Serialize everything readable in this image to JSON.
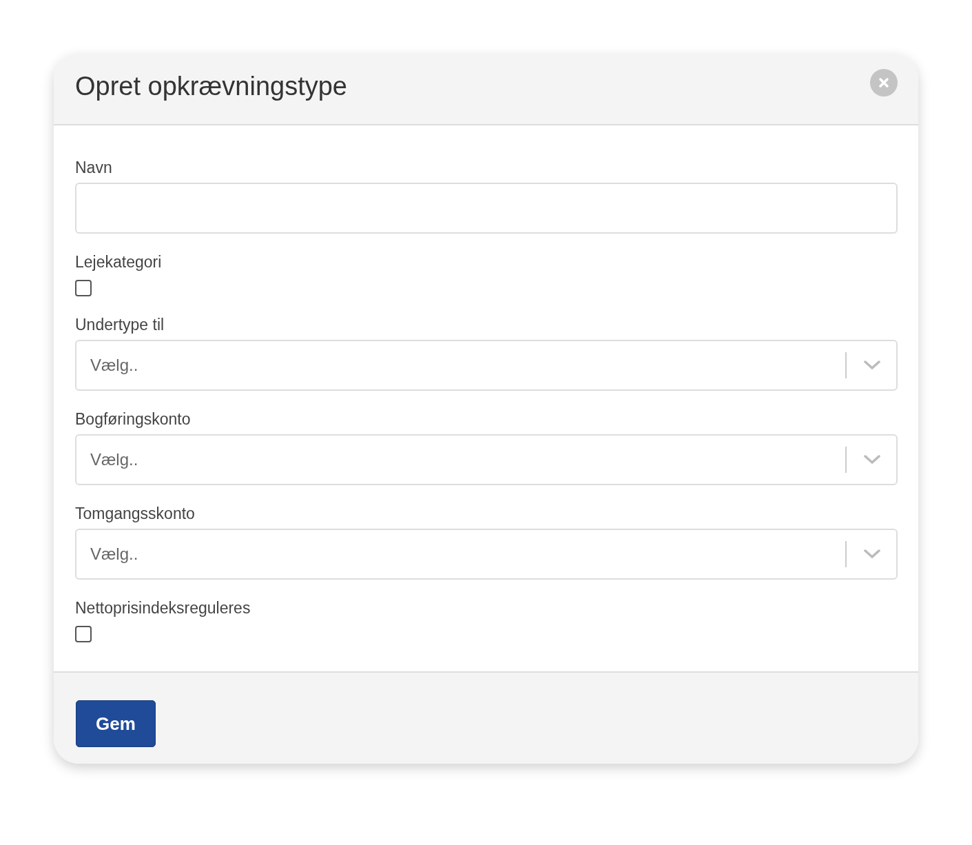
{
  "dialog": {
    "title": "Opret opkrævningstype"
  },
  "fields": [
    {
      "kind": "text",
      "label": "Navn"
    },
    {
      "kind": "checkbox",
      "label": "Lejekategori",
      "checked": false
    },
    {
      "kind": "select",
      "label": "Undertype til",
      "placeholder": "Vælg.."
    },
    {
      "kind": "select",
      "label": "Bogføringskonto",
      "placeholder": "Vælg.."
    },
    {
      "kind": "select",
      "label": "Tomgangsskonto",
      "placeholder": "Vælg.."
    },
    {
      "kind": "checkbox",
      "label": "Nettoprisindeksreguleres",
      "checked": false
    }
  ],
  "buttons": [
    "Gem"
  ]
}
